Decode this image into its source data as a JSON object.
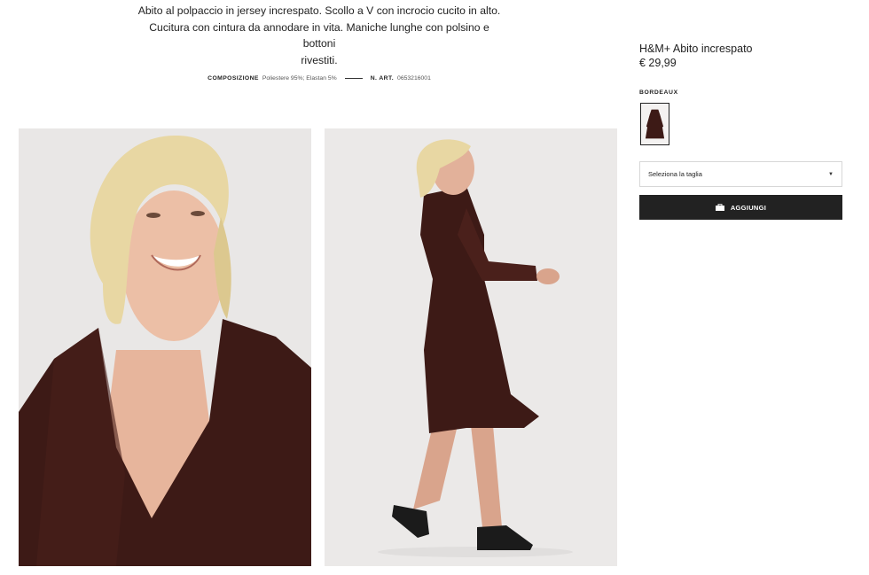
{
  "description": {
    "line1": "Abito al polpaccio in jersey increspato. Scollo a V con incrocio cucito in alto.",
    "line2": "Cucitura con cintura da annodare in vita. Maniche lunghe con polsino e bottoni",
    "line3": "rivestiti."
  },
  "meta": {
    "composition_label": "COMPOSIZIONE",
    "composition_value": "Poliestere 95%; Elastan 5%",
    "article_label": "N. ART.",
    "article_value": "0653216001"
  },
  "product": {
    "title": "H&M+ Abito increspato",
    "price": "€ 29,99",
    "color_name": "BORDEAUX",
    "size_placeholder": "Seleziona la taglia",
    "add_button": "AGGIUNGI"
  },
  "colors": {
    "dress": "#3d1a16",
    "button": "#222222",
    "photo_bg": "#ebe9e8"
  },
  "icons": {
    "caret": "caret-down-icon",
    "bag": "shopping-bag-icon"
  }
}
